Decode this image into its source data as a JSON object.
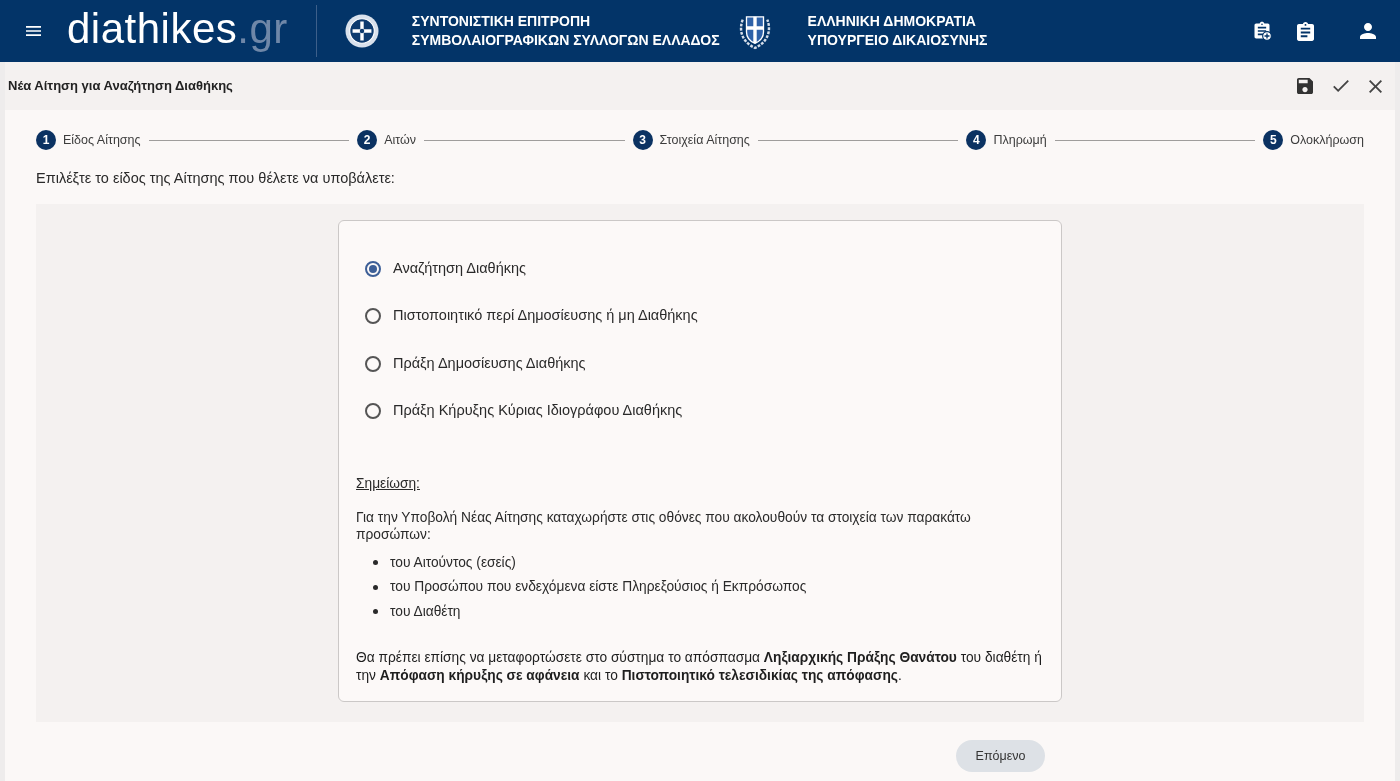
{
  "header": {
    "brand": {
      "name": "diathikes",
      "suffix": ".gr"
    },
    "organizations": [
      {
        "lines": [
          "ΣΥΝΤΟΝΙΣΤΙΚΗ ΕΠΙΤΡΟΠΗ",
          "ΣΥΜΒΟΛΑΙΟΓΡΑΦΙΚΩΝ ΣΥΛΛΟΓΩΝ ΕΛΛΑΔΟΣ"
        ]
      },
      {
        "lines": [
          "ΕΛΛΗΝΙΚΗ ΔΗΜΟΚΡΑΤΙΑ",
          "ΥΠΟΥΡΓΕΙΟ ΔΙΚΑΙΟΣΥΝΗΣ"
        ]
      }
    ]
  },
  "page": {
    "title": "Νέα Αίτηση για Αναζήτηση Διαθήκης"
  },
  "stepper": [
    {
      "number": "1",
      "label": "Είδος Αίτησης"
    },
    {
      "number": "2",
      "label": "Αιτών"
    },
    {
      "number": "3",
      "label": "Στοιχεία Αίτησης"
    },
    {
      "number": "4",
      "label": "Πληρωμή"
    },
    {
      "number": "5",
      "label": "Ολοκλήρωση"
    }
  ],
  "prompt": "Επιλέξτε το είδος της Αίτησης που θέλετε να υποβάλετε:",
  "options": [
    {
      "label": "Αναζήτηση Διαθήκης",
      "selected": true
    },
    {
      "label": "Πιστοποιητικό περί Δημοσίευσης ή μη Διαθήκης",
      "selected": false
    },
    {
      "label": "Πράξη Δημοσίευσης Διαθήκης",
      "selected": false
    },
    {
      "label": "Πράξη Κήρυξης Κύριας Ιδιογράφου Διαθήκης",
      "selected": false
    }
  ],
  "note": {
    "heading": "Σημείωση:",
    "intro": "Για την Υποβολή Νέας Αίτησης καταχωρήστε στις οθόνες που ακολουθούν τα στοιχεία των παρακάτω προσώπων:",
    "items": [
      "του Αιτούντος (εσείς)",
      "του Προσώπου που ενδεχόμενα είστε Πληρεξούσιος ή Εκπρόσωπος",
      "του Διαθέτη"
    ],
    "closing": "Θα πρέπει επίσης να μεταφορτώσετε στο σύστημα το απόσπασμα **Ληξιαρχικής Πράξης Θανάτου** του διαθέτη ή την **Απόφαση κήρυξης σε αφάνεια** και το **Πιστοποιητικό τελεσιδικίας της απόφασης**."
  },
  "next_button": "Επόμενο"
}
